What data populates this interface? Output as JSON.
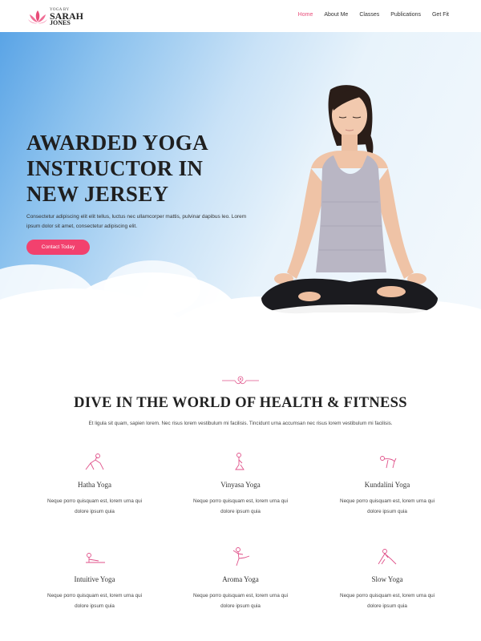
{
  "brand": {
    "tagline": "YOGA BY",
    "name_line1": "SARAH",
    "name_line2": "JONES"
  },
  "nav": {
    "items": [
      "Home",
      "About Me",
      "Classes",
      "Publications",
      "Get Fit"
    ],
    "active": "Home"
  },
  "hero": {
    "title": "AWARDED YOGA INSTRUCTOR IN NEW JERSEY",
    "description": "Consectetur adipiscing elit elit tellus, luctus nec ullamcorper mattis, pulvinar dapibus leo. Lorem ipsum dolor sit amet, consectetur adipiscing elit.",
    "button_label": "Contact Today"
  },
  "section": {
    "title": "DIVE IN THE WORLD OF HEALTH & FITNESS",
    "subtitle": "Et ligula sit quam, sapien lorem. Nec risus lorem vestibulum mi facilisis. Tincidunt urna accumsan nec risus lorem vestibulum mi facilisis."
  },
  "cards": [
    {
      "title": "Hatha Yoga",
      "text": "Neque porro quisquam est, lorem urna qui dolore ipsum quia",
      "icon": "yoga-pose-icon"
    },
    {
      "title": "Vinyasa Yoga",
      "text": "Neque porro quisquam est, lorem urna qui dolore ipsum quia",
      "icon": "yoga-pose-icon"
    },
    {
      "title": "Kundalini Yoga",
      "text": "Neque porro quisquam est, lorem urna qui dolore ipsum quia",
      "icon": "yoga-pose-icon"
    },
    {
      "title": "Intuitive Yoga",
      "text": "Neque porro quisquam est, lorem urna qui dolore ipsum quia",
      "icon": "yoga-pose-icon"
    },
    {
      "title": "Aroma Yoga",
      "text": "Neque porro quisquam est, lorem urna qui dolore ipsum quia",
      "icon": "yoga-pose-icon"
    },
    {
      "title": "Slow Yoga",
      "text": "Neque porro quisquam est, lorem urna qui dolore ipsum quia",
      "icon": "yoga-pose-icon"
    }
  ],
  "colors": {
    "accent": "#f2416e",
    "nav_active": "#e84b78",
    "icon": "#e0528a"
  }
}
